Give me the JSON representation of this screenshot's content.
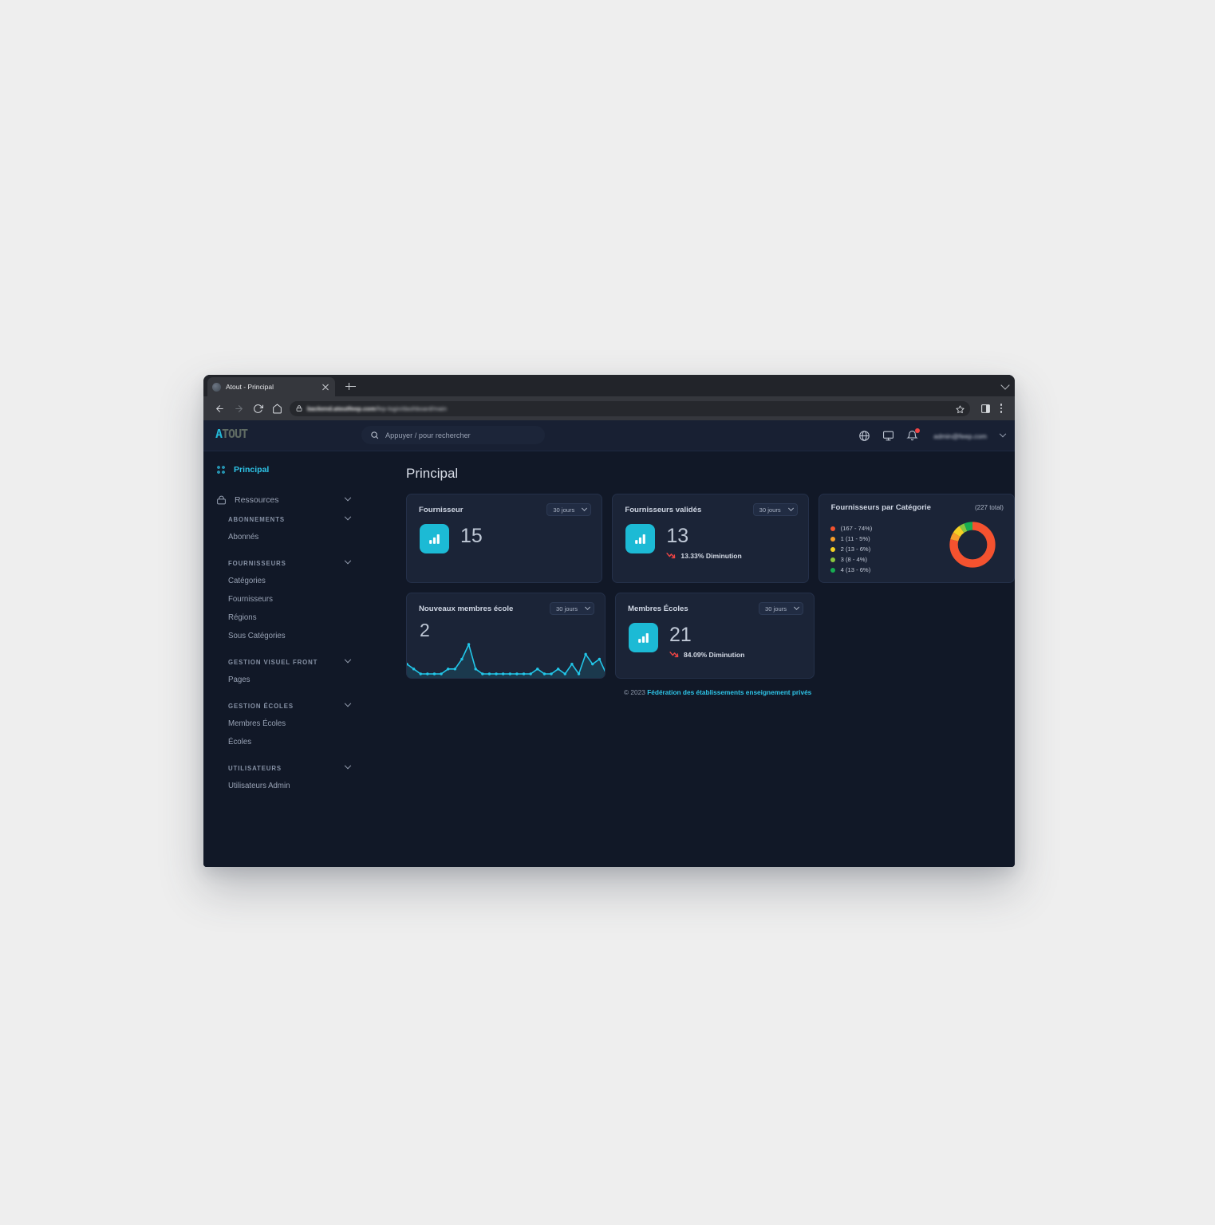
{
  "browser": {
    "tab_title": "Atout - Principal",
    "url_bold": "backend.atoutfeep.com",
    "url_rest": "/fep-login/dashboard/main",
    "icons": {
      "back": "back-arrow-icon",
      "forward": "forward-arrow-icon",
      "reload": "reload-icon",
      "home": "home-icon",
      "lock": "lock-icon",
      "star": "bookmark-star-icon",
      "panel": "side-panel-icon",
      "menu": "kebab-menu-icon",
      "new_tab": "new-tab-icon",
      "close_tab": "close-tab-icon",
      "window_caret": "chevron-down-icon"
    }
  },
  "navbar": {
    "logo_accent": "A",
    "logo_rest": "TOUT",
    "search_placeholder": "Appuyer / pour rechercher",
    "user_email": "admin@feep.com",
    "icons": [
      "globe-icon",
      "monitor-icon",
      "bell-icon"
    ],
    "has_notification": true
  },
  "sidebar": {
    "primary": [
      {
        "label": "Principal",
        "icon": "grid-dashboard-icon",
        "active": true,
        "caret": false
      },
      {
        "label": "Ressources",
        "icon": "box-icon",
        "active": false,
        "caret": true
      }
    ],
    "groups": [
      {
        "label": "ABONNEMENTS",
        "links": [
          "Abonnés"
        ]
      },
      {
        "label": "FOURNISSEURS",
        "links": [
          "Catégories",
          "Fournisseurs",
          "Régions",
          "Sous Catégories"
        ]
      },
      {
        "label": "GESTION VISUEL FRONT",
        "links": [
          "Pages"
        ]
      },
      {
        "label": "GESTION ÉCOLES",
        "links": [
          "Membres Écoles",
          "Écoles"
        ]
      },
      {
        "label": "UTILISATEURS",
        "links": [
          "Utilisateurs Admin"
        ]
      }
    ]
  },
  "page": {
    "title": "Principal"
  },
  "cards": {
    "fournisseur": {
      "title": "Fournisseur",
      "range": "30 jours",
      "value": "15",
      "icon": "bar-chart-icon"
    },
    "valides": {
      "title": "Fournisseurs validés",
      "range": "30 jours",
      "value": "13",
      "trend": "13.33% Diminution",
      "trend_direction": "down",
      "trend_color": "#ef4444",
      "icon": "bar-chart-icon"
    },
    "categorie": {
      "title": "Fournisseurs par Catégorie",
      "total": "(227 total)"
    },
    "nouveaux": {
      "title": "Nouveaux membres école",
      "range": "30 jours",
      "value": "2"
    },
    "membres": {
      "title": "Membres Écoles",
      "range": "30 jours",
      "value": "21",
      "trend": "84.09% Diminution",
      "trend_direction": "down",
      "trend_color": "#ef4444",
      "icon": "bar-chart-icon"
    }
  },
  "chart_data": [
    {
      "type": "pie",
      "name": "fournisseurs-par-categorie-donut",
      "title": "Fournisseurs par Catégorie",
      "total_label": "(227 total)",
      "total": 227,
      "legend_position": "left",
      "categories": [
        "",
        "1",
        "2",
        "3",
        "4"
      ],
      "values": [
        167,
        11,
        13,
        8,
        13
      ],
      "percents": [
        74,
        5,
        6,
        4,
        6
      ],
      "legend": [
        {
          "label": "(167 - 74%)",
          "color": "#f4522f"
        },
        {
          "label": "1 (11 - 5%)",
          "color": "#f79d2a"
        },
        {
          "label": "2 (13 - 6%)",
          "color": "#f5d024"
        },
        {
          "label": "3 (8 - 4%)",
          "color": "#8cc63e"
        },
        {
          "label": "4 (13 - 6%)",
          "color": "#17ad52"
        }
      ],
      "extra_slice_color": "#6d6ae0"
    },
    {
      "type": "area",
      "name": "nouveaux-membres-ecole-sparkline",
      "title": "Nouveaux membres école",
      "ylabel": "",
      "xlabel": "",
      "grid": false,
      "legend_position": "none",
      "line_color": "#22c6e8",
      "x": [
        0,
        1,
        2,
        3,
        4,
        5,
        6,
        7,
        8,
        9,
        10,
        11,
        12,
        13,
        14,
        15,
        16,
        17,
        18,
        19,
        20,
        21,
        22,
        23,
        24,
        25,
        26,
        27,
        28,
        29
      ],
      "values": [
        2,
        1,
        0,
        0,
        0,
        0,
        1,
        1,
        3,
        6,
        1,
        0,
        0,
        0,
        0,
        0,
        0,
        0,
        0,
        1,
        0,
        0,
        1,
        0,
        2,
        0,
        4,
        2,
        3,
        0
      ]
    }
  ],
  "footer": {
    "copyright": "© 2023 ",
    "link": "Fédération des établissements enseignement privés"
  }
}
